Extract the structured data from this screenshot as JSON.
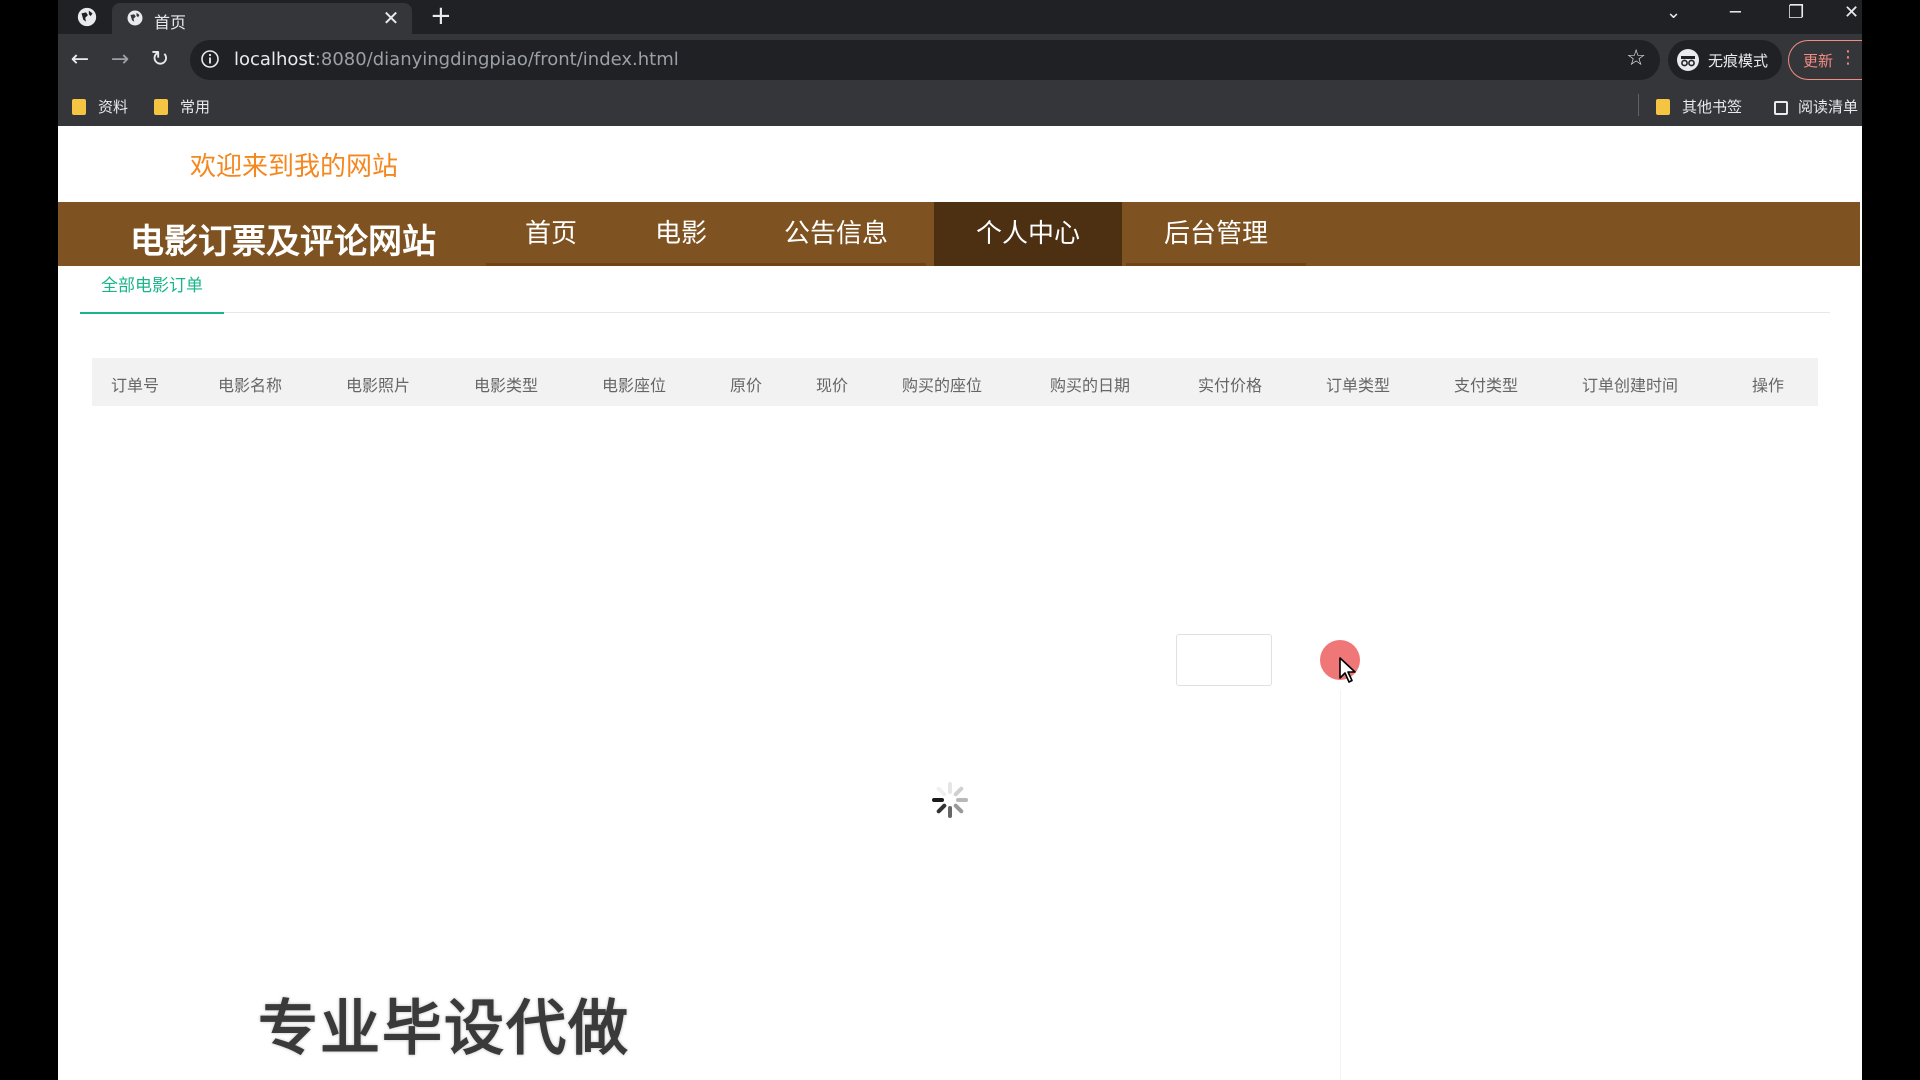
{
  "browser": {
    "tab_title": "首页",
    "tab_close": "✕",
    "new_tab": "+",
    "window_controls": {
      "dropdown": "⌄",
      "minimize": "─",
      "restore": "❐",
      "close": "✕"
    },
    "url_host": "localhost",
    "url_rest": ":8080/dianyingdingpiao/front/index.html",
    "incognito_label": "无痕模式",
    "update_label": "更新",
    "bookmarks": [
      "资料",
      "常用"
    ],
    "other_bookmarks": "其他书签",
    "reading_list": "阅读清单"
  },
  "page": {
    "welcome": "欢迎来到我的网站",
    "brand": "电影订票及评论网站",
    "nav": [
      "首页",
      "电影",
      "公告信息",
      "个人中心",
      "后台管理"
    ],
    "active_nav_index": 3,
    "subtab": "全部电影订单",
    "table_headers": [
      "订单号",
      "电影名称",
      "电影照片",
      "电影类型",
      "电影座位",
      "原价",
      "现价",
      "购买的座位",
      "购买的日期",
      "实付价格",
      "订单类型",
      "支付类型",
      "订单创建时间",
      "操作"
    ],
    "watermark": "专业毕设代做"
  },
  "colors": {
    "welcome": "#f5871f",
    "nav_bg": "#7f5321",
    "nav_active": "#4d2f12",
    "subtab_accent": "#19b58a"
  },
  "icons": {
    "back": "back-arrow-icon",
    "forward": "forward-arrow-icon",
    "reload": "reload-icon",
    "star": "bookmark-star-icon",
    "spinner": "loading-spinner-icon"
  }
}
